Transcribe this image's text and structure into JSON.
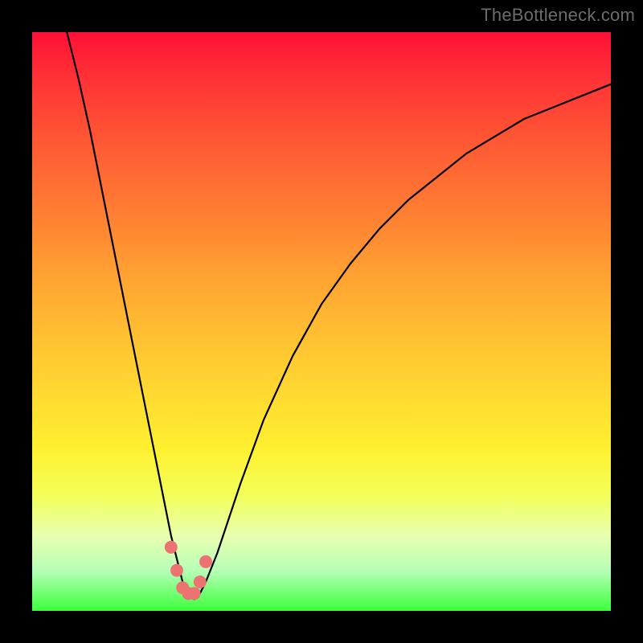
{
  "watermark": "TheBottleneck.com",
  "colors": {
    "black_border": "#000000",
    "curve_stroke": "#000000",
    "marker_fill": "#ed7373",
    "gradient_top": "#ff1037",
    "gradient_bottom": "#3cff3c"
  },
  "chart_data": {
    "type": "line",
    "title": "",
    "xlabel": "",
    "ylabel": "",
    "xlim": [
      0,
      100
    ],
    "ylim": [
      0,
      100
    ],
    "grid": false,
    "legend": false,
    "series": [
      {
        "name": "bottleneck-curve",
        "x": [
          6,
          8,
          10,
          12,
          14,
          16,
          18,
          20,
          22,
          24,
          25,
          26,
          27,
          28,
          29,
          30,
          32,
          36,
          40,
          45,
          50,
          55,
          60,
          65,
          70,
          75,
          80,
          85,
          90,
          95,
          100
        ],
        "y": [
          100,
          92,
          83,
          73,
          63,
          53,
          43,
          33,
          23,
          13,
          9,
          5,
          3,
          2,
          3,
          5,
          10,
          22,
          33,
          44,
          53,
          60,
          66,
          71,
          75,
          79,
          82,
          85,
          87,
          89,
          91
        ]
      }
    ],
    "markers": {
      "name": "valley-markers",
      "x": [
        24.0,
        25.0,
        26.0,
        27.0,
        28.0,
        29.0,
        30.0
      ],
      "y": [
        11.0,
        7.0,
        4.0,
        3.0,
        3.0,
        5.0,
        8.5
      ]
    }
  }
}
